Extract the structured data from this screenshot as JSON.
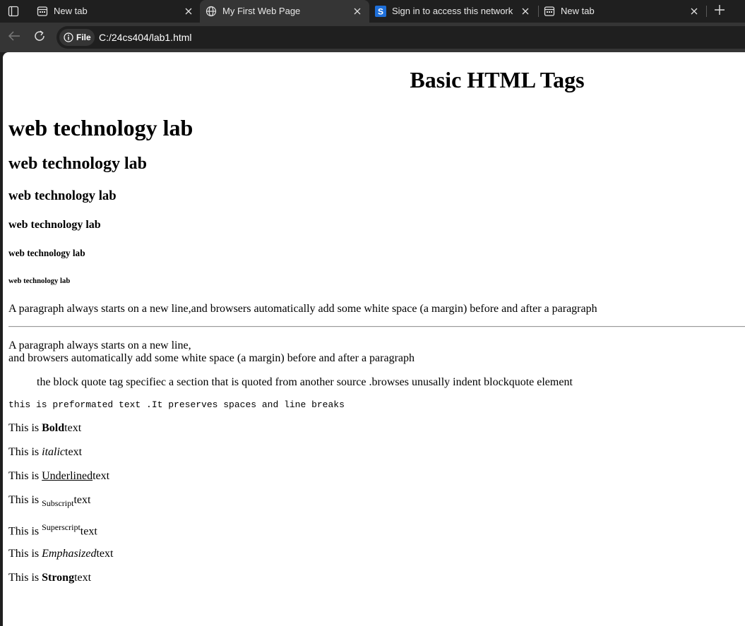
{
  "browser": {
    "tabs": [
      {
        "title": "New tab",
        "icon": "newtab-icon",
        "active": false
      },
      {
        "title": "My First Web Page",
        "icon": "globe-icon",
        "active": true
      },
      {
        "title": "Sign in to access this network",
        "icon": "s-logo-icon",
        "active": false
      },
      {
        "title": "New tab",
        "icon": "newtab-icon",
        "active": false
      }
    ],
    "site_chip_label": "File",
    "url": "C:/24cs404/lab1.html",
    "colors": {
      "frame": "#1f1f1f",
      "active_tab": "#353535",
      "toolbar": "#353535",
      "s_logo": "#1e6fd9"
    }
  },
  "page": {
    "title_heading": "Basic HTML Tags",
    "headings": [
      "web technology lab",
      "web technology lab",
      "web technology lab",
      "web technology lab",
      "web technology lab",
      "web technology lab"
    ],
    "paragraph1": "A paragraph always starts on a new line,and browsers automatically add some white space (a margin) before and after a paragraph",
    "paragraph2_line1": "A paragraph always starts on a new line,",
    "paragraph2_line2": "and browsers automatically add some white space (a margin) before and after a paragraph",
    "blockquote": "the block quote tag specifiec a section that is quoted from another source .browses unusally indent blockquote element",
    "preformatted": "this is preformated text .It preserves spaces and line breaks",
    "formatting": {
      "prefix": "This is ",
      "suffix": "text",
      "bold": "Bold",
      "italic": "italic",
      "underlined": "Underlined",
      "subscript": "Subscript",
      "superscript": "Superscript",
      "emphasized": "Emphasized",
      "strong": "Strong"
    }
  }
}
